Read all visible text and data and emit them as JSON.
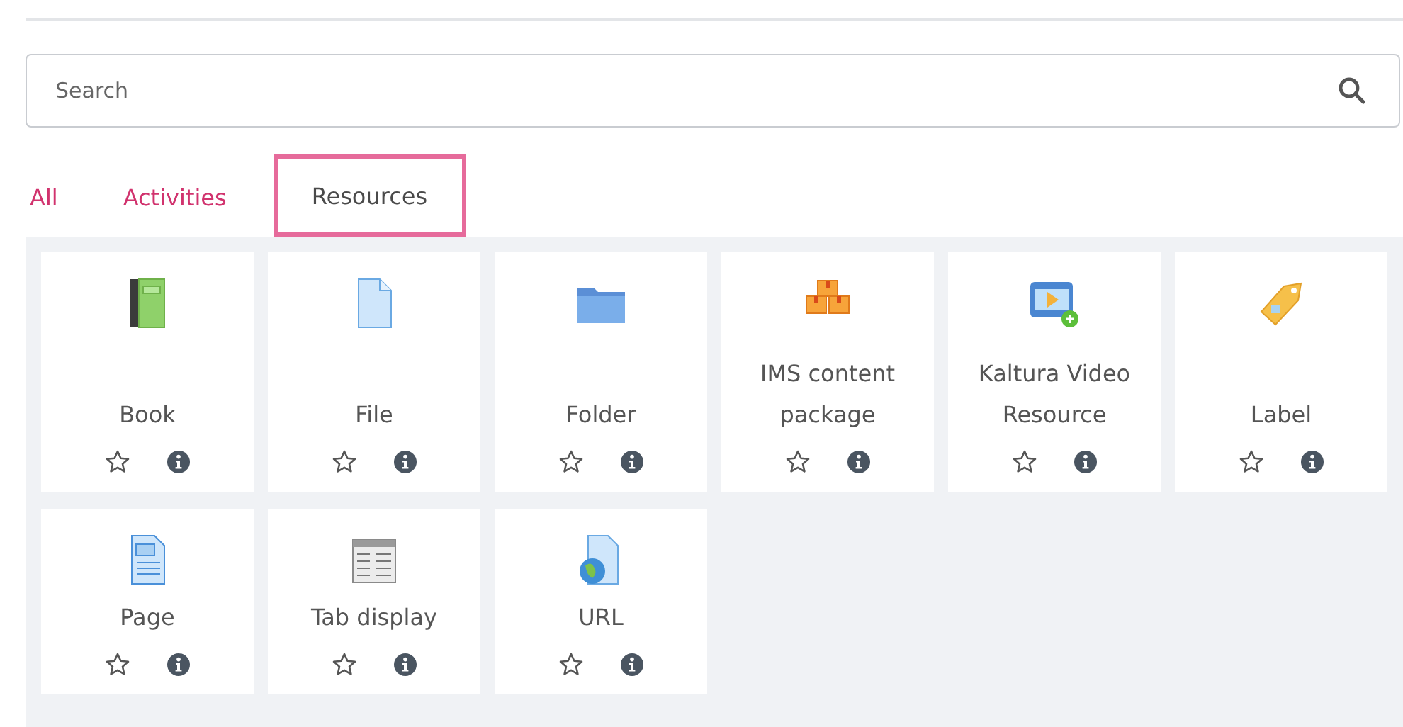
{
  "search": {
    "placeholder": "Search"
  },
  "tabs": [
    {
      "label": "All",
      "selected": false
    },
    {
      "label": "Activities",
      "selected": false
    },
    {
      "label": "Resources",
      "selected": true
    }
  ],
  "items": [
    {
      "name": "Book",
      "kind": "book",
      "starred": false
    },
    {
      "name": "File",
      "kind": "file",
      "starred": false
    },
    {
      "name": "Folder",
      "kind": "folder",
      "starred": false
    },
    {
      "name": "IMS content package",
      "kind": "boxes",
      "starred": false
    },
    {
      "name": "Kaltura Video Resource",
      "kind": "video",
      "starred": false
    },
    {
      "name": "Label",
      "kind": "tag",
      "starred": false
    },
    {
      "name": "Page",
      "kind": "page",
      "starred": false
    },
    {
      "name": "Tab display",
      "kind": "table",
      "starred": false
    },
    {
      "name": "URL",
      "kind": "globe",
      "starred": false
    }
  ]
}
